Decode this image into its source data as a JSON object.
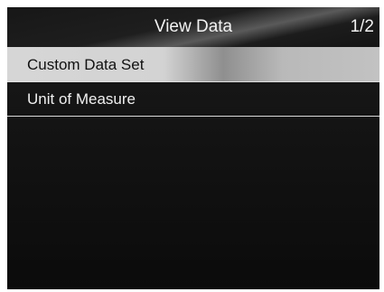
{
  "header": {
    "title": "View Data",
    "page": "1/2"
  },
  "menu": {
    "items": [
      {
        "label": "Custom Data Set",
        "selected": true
      },
      {
        "label": "Unit of Measure",
        "selected": false
      }
    ]
  }
}
